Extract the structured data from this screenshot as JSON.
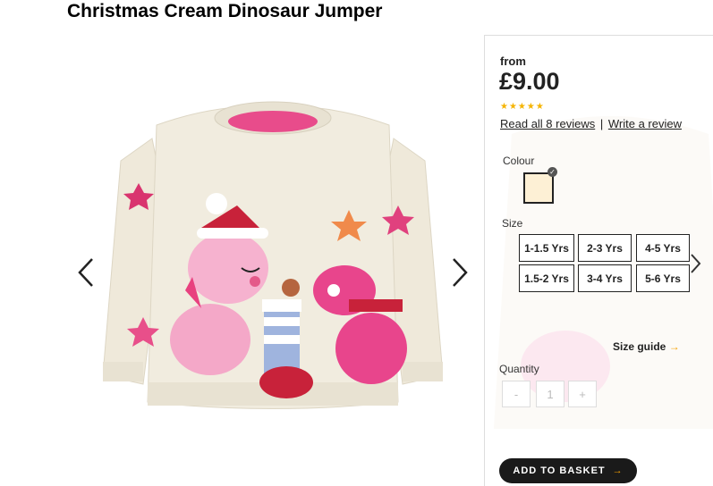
{
  "product": {
    "title": "Christmas Cream Dinosaur Jumper"
  },
  "gallery": {
    "prev_icon": "chevron-left-icon",
    "next_icon": "chevron-right-icon"
  },
  "pricing": {
    "from_label": "from",
    "price": "£9.00",
    "stars": "★★★★★",
    "rating": 5,
    "reviews_link": "Read all 8 reviews",
    "separator": "|",
    "write_review": "Write a review"
  },
  "colour": {
    "label": "Colour",
    "selected_swatch": "#fdf0d5"
  },
  "size": {
    "label": "Size",
    "options": [
      "1-1.5 Yrs",
      "2-3 Yrs",
      "4-5 Yrs",
      "1.5-2 Yrs",
      "3-4 Yrs",
      "5-6 Yrs"
    ],
    "guide": "Size guide",
    "guide_arrow": "→"
  },
  "quantity": {
    "label": "Quantity",
    "minus": "-",
    "value": "1",
    "plus": "+"
  },
  "basket": {
    "label": "ADD TO BASKET",
    "arrow": "→"
  },
  "colors": {
    "accent": "#f5a000",
    "star": "#f5b400",
    "button_bg": "#1a1a1a"
  }
}
